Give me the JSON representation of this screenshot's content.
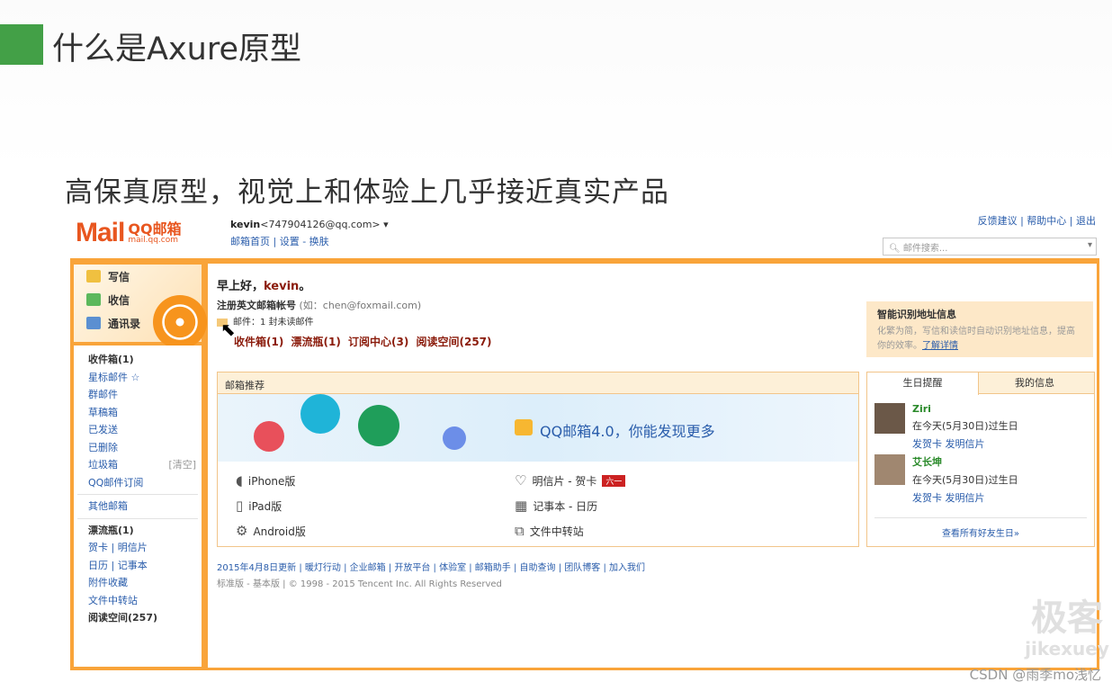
{
  "slide": {
    "title": "什么是Axure原型",
    "subtitle": "高保真原型，视觉上和体验上几乎接近真实产品"
  },
  "colors": {
    "accent_green": "#43a047",
    "mail_orange": "#f9a43a",
    "link_blue": "#2a5dab"
  },
  "mail": {
    "logo_text": "Mail",
    "logo_cn": "QQ邮箱",
    "logo_url": "mail.qq.com",
    "user_name": "kevin",
    "user_email": "<747904126@qq.com> ▾",
    "user_links": "邮箱首页 | 设置 - 换肤",
    "top_links": "反馈建议 | 帮助中心 | 退出",
    "search_placeholder": "邮件搜索...",
    "quick": [
      {
        "label": "写信"
      },
      {
        "label": "收信"
      },
      {
        "label": "通讯录"
      }
    ],
    "folders": [
      "收件箱(1)",
      "星标邮件 ☆",
      "群邮件",
      "草稿箱",
      "已发送",
      "已删除",
      "垃圾箱",
      "QQ邮件订阅",
      "其他邮箱",
      "漂流瓶(1)",
      "贺卡 | 明信片",
      "日历 | 记事本",
      "附件收藏",
      "文件中转站",
      "阅读空间(257)"
    ],
    "clear_label": "[清空]",
    "greeting_prefix": "早上好，",
    "greeting_name": "kevin",
    "greeting_suffix": "。",
    "register_text": "注册英文邮箱帐号",
    "register_hint": "(如：chen@foxmail.com)",
    "unread_text": "邮件：1 封未读邮件",
    "counts": "收件箱(1) 漂流瓶(1) 订阅中心(3) 阅读空间(257)",
    "smart_title": "智能识别地址信息",
    "smart_desc": "化繁为简，写信和读信时自动识别地址信息，提高你的效率。",
    "smart_link": "了解详情",
    "rec_title": "邮箱推荐",
    "banner_text": "QQ邮箱4.0，你能发现更多",
    "apps": [
      {
        "label": "iPhone版",
        "icon": ""
      },
      {
        "label": "明信片 - 贺卡",
        "icon": "♡"
      },
      {
        "label": "iPad版",
        "icon": "▯"
      },
      {
        "label": "记事本 - 日历",
        "icon": "▦"
      },
      {
        "label": "Android版",
        "icon": "⚙"
      },
      {
        "label": "文件中转站",
        "icon": "⧉"
      }
    ],
    "bday_tab1": "生日提醒",
    "bday_tab2": "我的信息",
    "people": [
      {
        "name": "Ziri",
        "date": "在今天(5月30日)过生日",
        "links": "发贺卡  发明信片"
      },
      {
        "name": "艾长坤",
        "date": "在今天(5月30日)过生日",
        "links": "发贺卡  发明信片"
      }
    ],
    "bday_more": "查看所有好友生日»",
    "footer1": "2015年4月8日更新 | 暖灯行动 | 企业邮箱 | 开放平台 | 体验室 | 邮箱助手 | 自助查询 | 团队博客 | 加入我们",
    "footer2": "标准版 - 基本版 | © 1998 - 2015 Tencent Inc. All Rights Reserved"
  },
  "watermark": {
    "brand": "极客",
    "sub": "jikexuey"
  },
  "csdn": "CSDN @雨季mo浅忆"
}
